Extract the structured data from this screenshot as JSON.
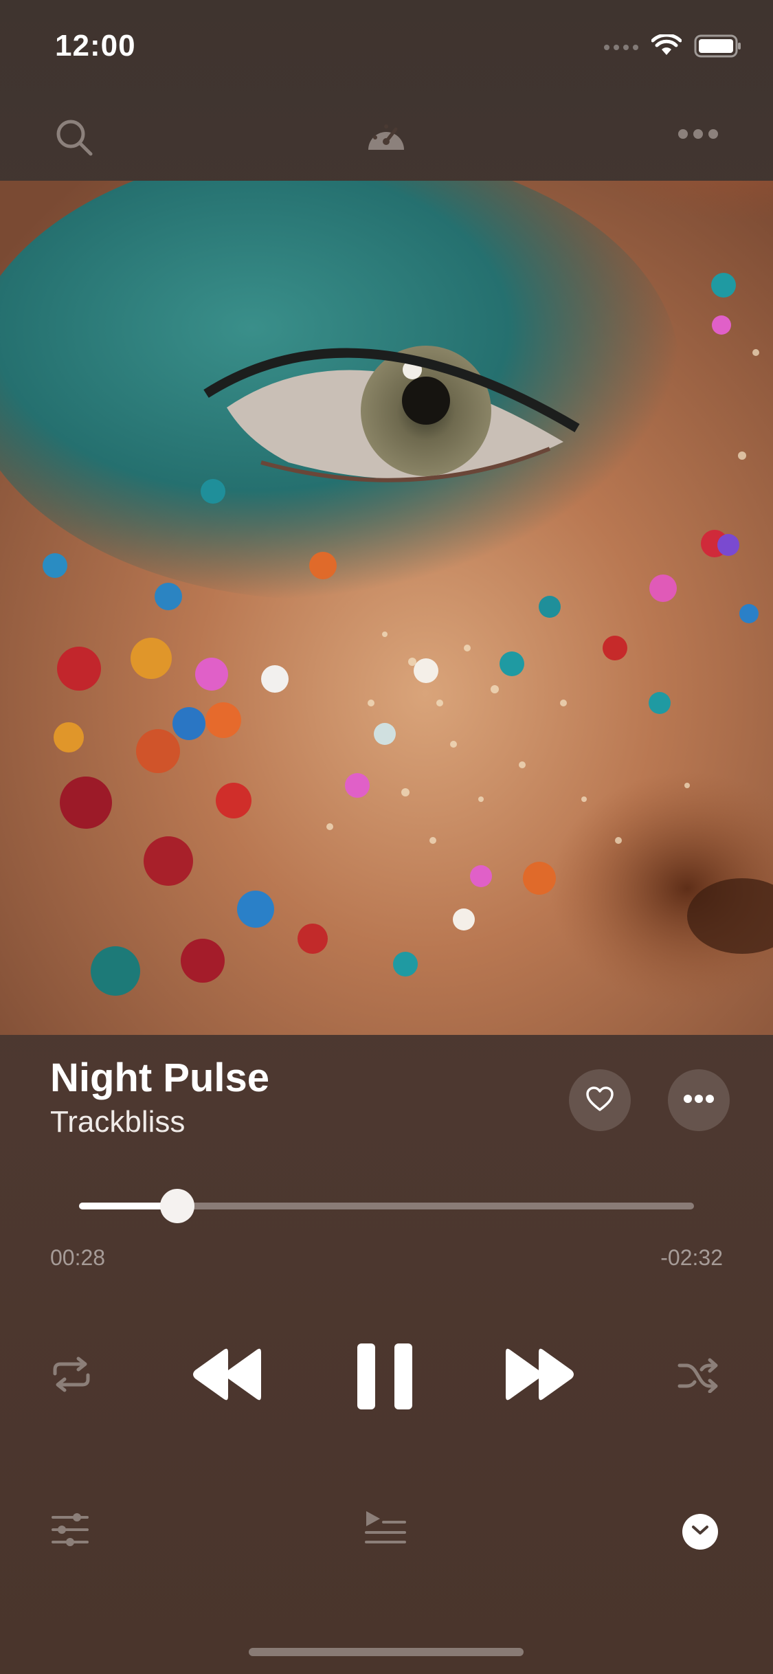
{
  "status_bar": {
    "time": "12:00",
    "icons": [
      "cellular-signal-icon",
      "wifi-icon",
      "battery-icon"
    ]
  },
  "toolbar": {
    "icons": [
      "search-icon",
      "speedometer-icon",
      "more-horizontal-icon"
    ]
  },
  "album_art": {
    "description_icon": "album-cover-image"
  },
  "track": {
    "title": "Night Pulse",
    "artist": "Trackbliss"
  },
  "actions": {
    "icons": [
      "heart-icon",
      "more-horizontal-icon"
    ]
  },
  "progress": {
    "elapsed": "00:28",
    "remaining": "-02:32",
    "fraction": 0.16
  },
  "controls": {
    "icons": [
      "repeat-icon",
      "rewind-icon",
      "pause-icon",
      "fast-forward-icon",
      "shuffle-icon"
    ]
  },
  "bottom_bar": {
    "icons": [
      "equalizer-icon",
      "queue-icon",
      "collapse-chevron-icon"
    ]
  },
  "colors": {
    "background": "#4a3a33",
    "accent": "#ffffff",
    "muted": "#8c7f79"
  }
}
